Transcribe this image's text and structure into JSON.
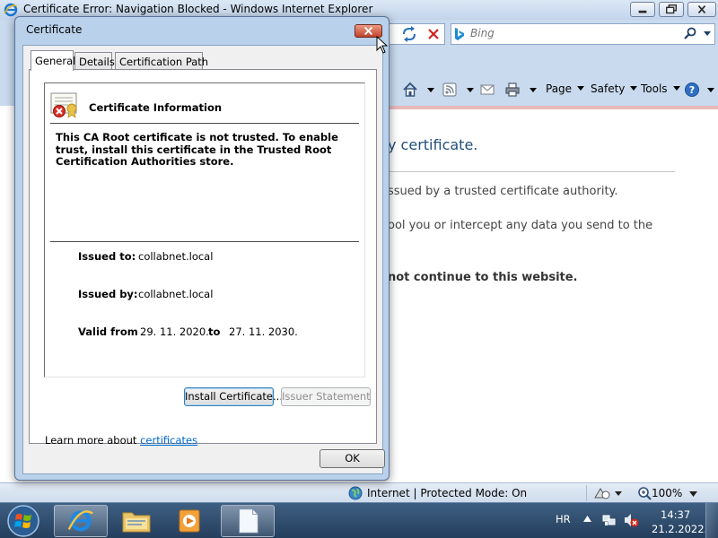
{
  "browser": {
    "title": "Certificate Error: Navigation Blocked - Windows Internet Explorer",
    "search": {
      "placeholder": "Bing"
    },
    "commands": {
      "page": "Page",
      "safety": "Safety",
      "tools": "Tools"
    },
    "page_content": {
      "heading": "y certificate.",
      "line1": "ssued by a trusted certificate authority.",
      "line2": "ool you or intercept any data you send to the",
      "line3": "not continue to this website."
    },
    "status": {
      "zone": "Internet | Protected Mode: On",
      "zoom": "100%"
    }
  },
  "dialog": {
    "title": "Certificate",
    "tabs": [
      "General",
      "Details",
      "Certification Path"
    ],
    "active_tab": "General",
    "info_heading": "Certificate Information",
    "trust_message": "This CA Root certificate is not trusted. To enable trust, install this certificate in the Trusted Root Certification Authorities store.",
    "issued_to_label": "Issued to:",
    "issued_to": "collabnet.local",
    "issued_by_label": "Issued by:",
    "issued_by": "collabnet.local",
    "valid_from_label": "Valid from",
    "valid_from": "29. 11. 2020.",
    "valid_to_label": "to",
    "valid_to": "27. 11. 2030.",
    "buttons": {
      "install": "Install Certificate...",
      "issuer_statement": "Issuer Statement",
      "ok": "OK"
    },
    "learn_more_prefix": "Learn more about",
    "learn_more_link": "certificates"
  },
  "taskbar": {
    "language": "HR",
    "time": "14:37",
    "date": "21.2.2022."
  },
  "colors": {
    "link": "#0066cc",
    "error_red": "#c3432b",
    "accent_blue": "#1f4e79"
  }
}
